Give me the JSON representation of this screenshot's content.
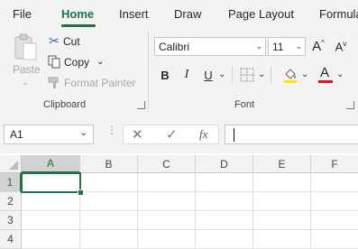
{
  "tabs": [
    {
      "label": "File"
    },
    {
      "label": "Home"
    },
    {
      "label": "Insert"
    },
    {
      "label": "Draw"
    },
    {
      "label": "Page Layout"
    },
    {
      "label": "Formula"
    }
  ],
  "active_tab": "Home",
  "accent_color": "#217346",
  "clipboard": {
    "label": "Clipboard",
    "paste": "Paste",
    "cut": "Cut",
    "copy": "Copy",
    "format_painter": "Format Painter"
  },
  "font": {
    "label": "Font",
    "font_name": "Calibri",
    "font_size": "11",
    "bold": "B",
    "italic": "I",
    "underline": "U",
    "font_color": "#e81123"
  },
  "formula_bar": {
    "name_box": "A1",
    "fx": "fx",
    "content": ""
  },
  "columns": [
    "A",
    "B",
    "C",
    "D",
    "E",
    "F"
  ],
  "rows": [
    "1",
    "2",
    "3",
    "4"
  ],
  "selected_cell": "A1"
}
